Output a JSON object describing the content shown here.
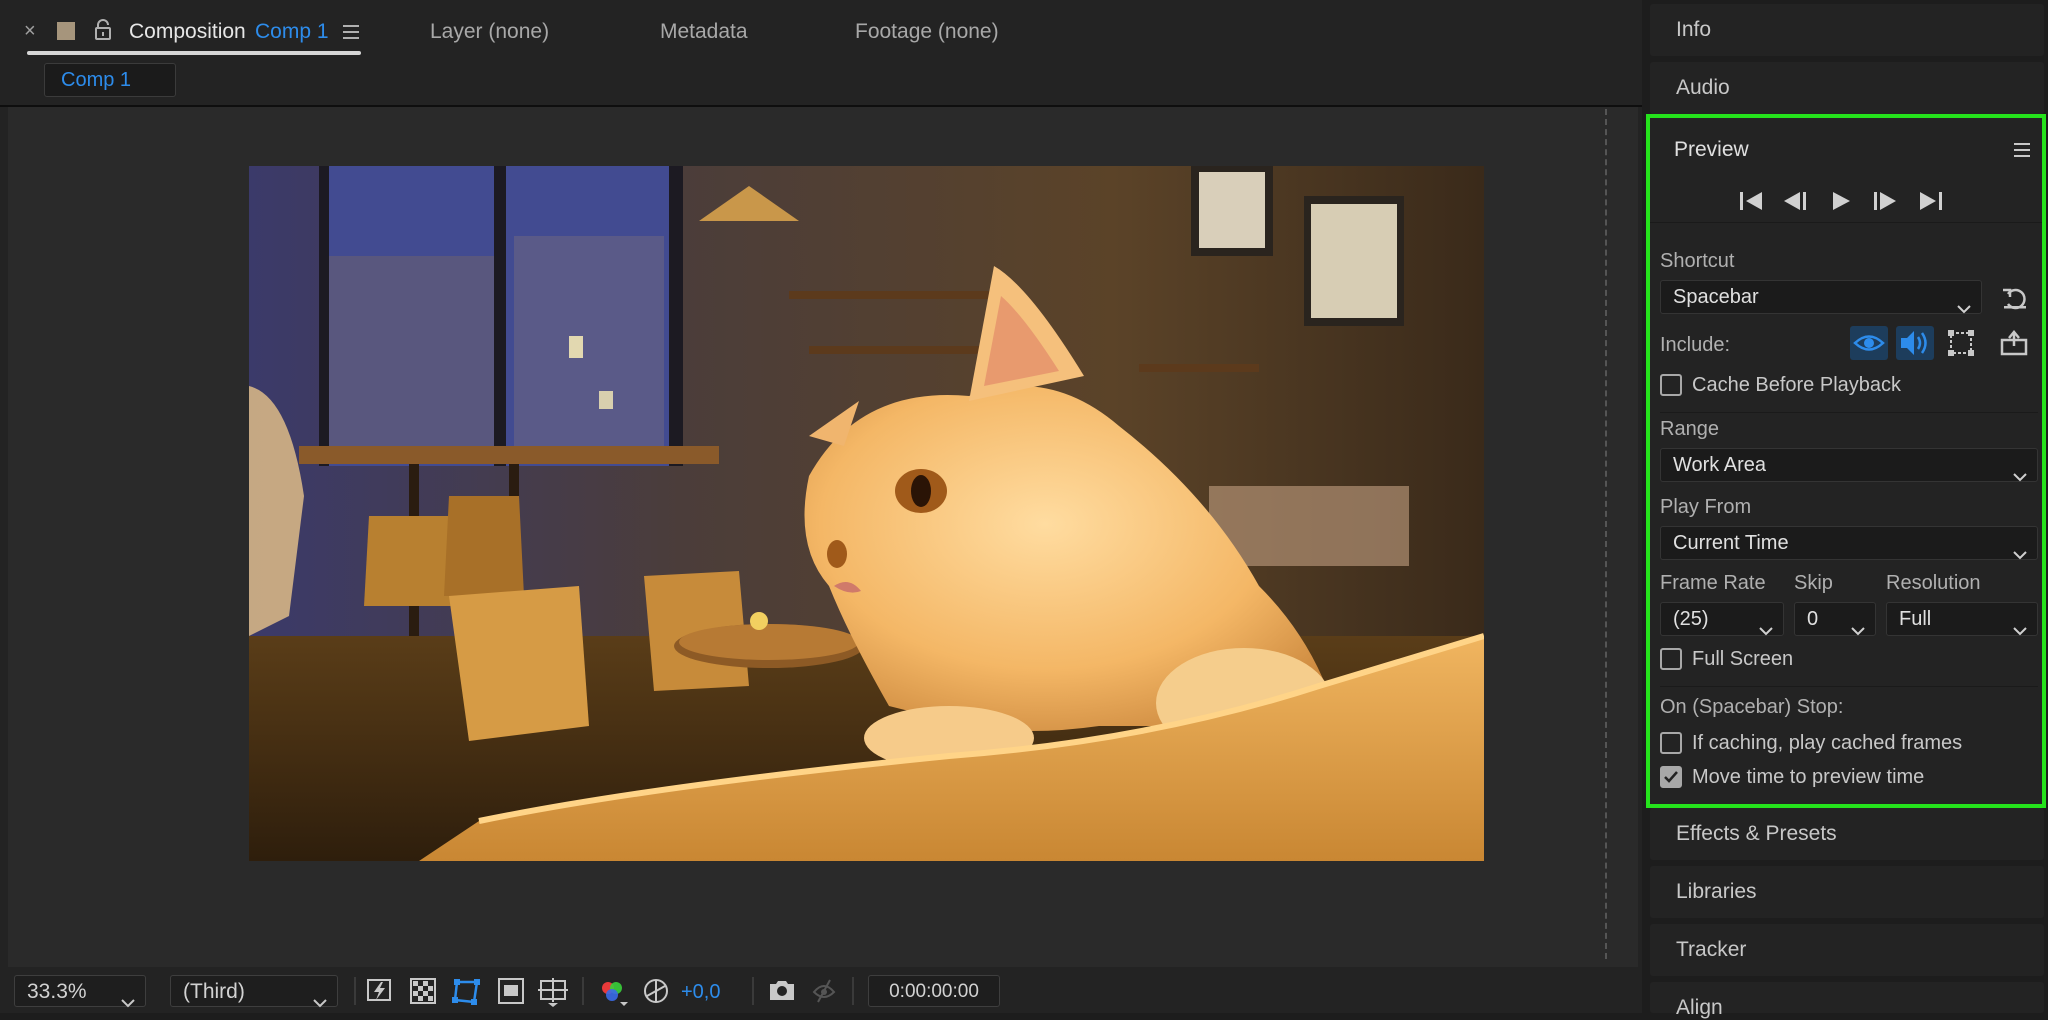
{
  "composition_tab": {
    "close_glyph": "×",
    "label": "Composition",
    "comp_name": "Comp 1",
    "swatch_color": "#a6957c"
  },
  "other_tabs": {
    "layer": "Layer (none)",
    "metadata": "Metadata",
    "footage": "Footage (none)"
  },
  "breadcrumb": {
    "comp": "Comp 1"
  },
  "viewer": {
    "image_description": "orange cat in cafe",
    "background_color": "#2a2a2a"
  },
  "toolbar": {
    "zoom": "33.3%",
    "resolution": "(Third)",
    "exposure": "+0,0",
    "timecode": "0:00:00:00",
    "icons": [
      "fast-previews-icon",
      "transparency-grid-icon",
      "mask-path-icon",
      "region-of-interest-icon",
      "safe-margins-icon",
      "color-channels-icon",
      "reset-exposure-icon",
      "snapshot-icon",
      "show-snapshot-icon"
    ]
  },
  "panels": {
    "info": "Info",
    "audio": "Audio",
    "effects": "Effects & Presets",
    "libraries": "Libraries",
    "tracker": "Tracker",
    "align": "Align"
  },
  "preview": {
    "title": "Preview",
    "highlight_color": "#25e31c",
    "transport_icons": [
      "first-frame-icon",
      "previous-frame-icon",
      "play-icon",
      "next-frame-icon",
      "last-frame-icon"
    ],
    "shortcut_label": "Shortcut",
    "shortcut_value": "Spacebar",
    "include_label": "Include:",
    "include_video_on": true,
    "include_audio_on": true,
    "include_overlays_on": false,
    "cache_before_playback": {
      "label": "Cache Before Playback",
      "checked": false
    },
    "range_label": "Range",
    "range_value": "Work Area",
    "play_from_label": "Play From",
    "play_from_value": "Current Time",
    "frame_rate_label": "Frame Rate",
    "frame_rate_value": "(25)",
    "skip_label": "Skip",
    "skip_value": "0",
    "resolution_label": "Resolution",
    "resolution_value": "Full",
    "full_screen": {
      "label": "Full Screen",
      "checked": false
    },
    "on_stop_label": "On (Spacebar) Stop:",
    "if_caching": {
      "label": "If caching, play cached frames",
      "checked": false
    },
    "move_time": {
      "label": "Move time to preview time",
      "checked": true
    }
  }
}
